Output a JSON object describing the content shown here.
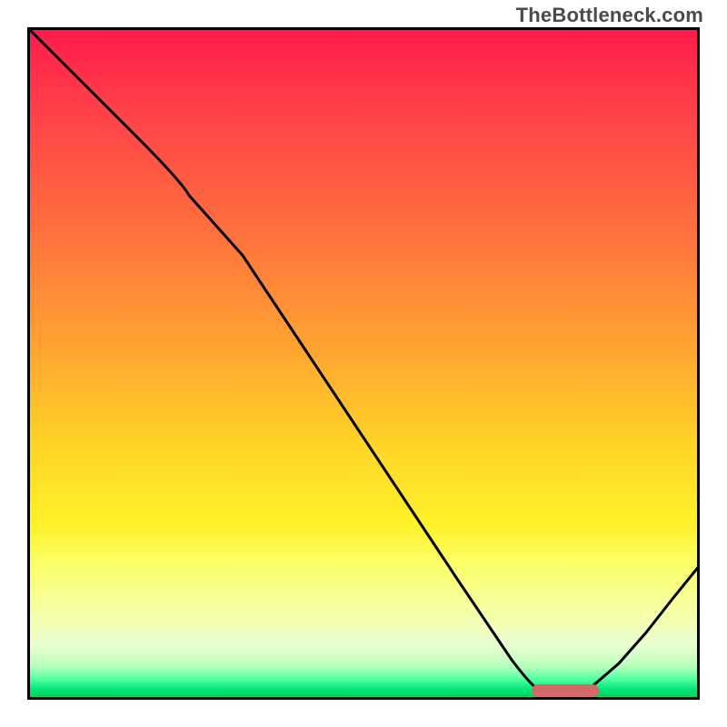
{
  "watermark": "TheBottleneck.com",
  "colors": {
    "frame": "#000000",
    "curve": "#000000",
    "marker_fill": "#d36a6a",
    "gradient_top": "#ff1a4a",
    "gradient_bottom": "#00c853"
  },
  "chart_data": {
    "type": "line",
    "title": "",
    "xlabel": "",
    "ylabel": "",
    "xlim": [
      0,
      100
    ],
    "ylim": [
      0,
      100
    ],
    "grid": false,
    "legend": false,
    "note": "Axes have no tick labels; values below are read in percent of the plot frame (0,0 = bottom-left, 100,100 = top-right).",
    "series": [
      {
        "name": "curve",
        "x": [
          0,
          8,
          16,
          24,
          32,
          40,
          48,
          56,
          64,
          72,
          76,
          80,
          84,
          88,
          92,
          96,
          100
        ],
        "y": [
          100,
          92,
          84,
          77,
          66,
          54,
          42,
          30,
          18,
          6,
          2,
          1,
          1,
          2,
          6,
          12,
          20
        ]
      }
    ],
    "marker": {
      "shape": "rounded-bar",
      "x_center": 80,
      "y_center": 1,
      "width": 10,
      "height": 2,
      "fill": "#d36a6a"
    }
  }
}
